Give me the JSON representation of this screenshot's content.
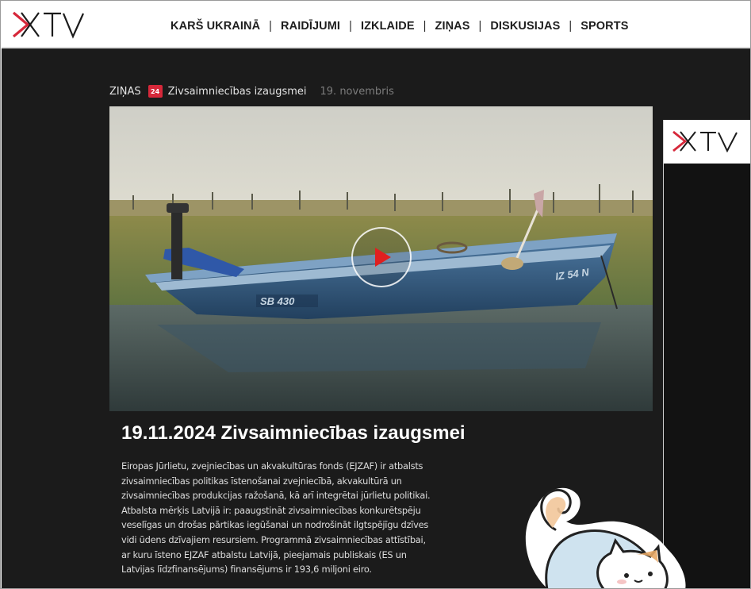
{
  "brand": {
    "logo_icon": "xtv-logo-icon",
    "accent": "#d6283a"
  },
  "nav": {
    "items": [
      "KARŠ UKRAINĀ",
      "RAIDĪJUMI",
      "IZKLAIDE",
      "ZIŅAS",
      "DISKUSIJAS",
      "SPORTS"
    ],
    "separator": "|"
  },
  "breadcrumb": {
    "section": "ZIŅAS",
    "badge": "24",
    "show": "Zivsaimniecības izaugsmei",
    "date": "19. novembris"
  },
  "video": {
    "boat_label": "SB 430",
    "boat_side_label": "IZ 54 N",
    "play_icon": "play-icon"
  },
  "article": {
    "title": "19.11.2024 Zivsaimniecības izaugsmei",
    "lines": [
      "Eiropas Jūrlietu, zvejniecības un akvakultūras fonds (EJZAF) ir atbalsts",
      "zivsaimniecības politikas īstenošanai zvejniecībā, akvakultūrā un",
      "zivsaimniecības produkcijas ražošanā, kā arī integrētai jūrlietu politikai.",
      "Atbalsta mērķis Latvijā ir: paaugstināt zivsaimniecības konkurētspēju",
      "veselīgas un drošas pārtikas iegūšanai un nodrošināt ilgtspējīgu dzīves",
      "vidi ūdens dzīvajiem resursiem. Programmā zivsaimniecības attīstībai,",
      "ar kuru īsteno EJZAF atbalstu Latvijā, pieejamais publiskais (ES un",
      "Latvijas līdzfinansējums) finansējums ir 193,6 miljoni eiro."
    ]
  },
  "side_widget": {
    "logo_icon": "xtv-logo-icon"
  },
  "sticker": {
    "icon": "cat-sticker-icon"
  }
}
